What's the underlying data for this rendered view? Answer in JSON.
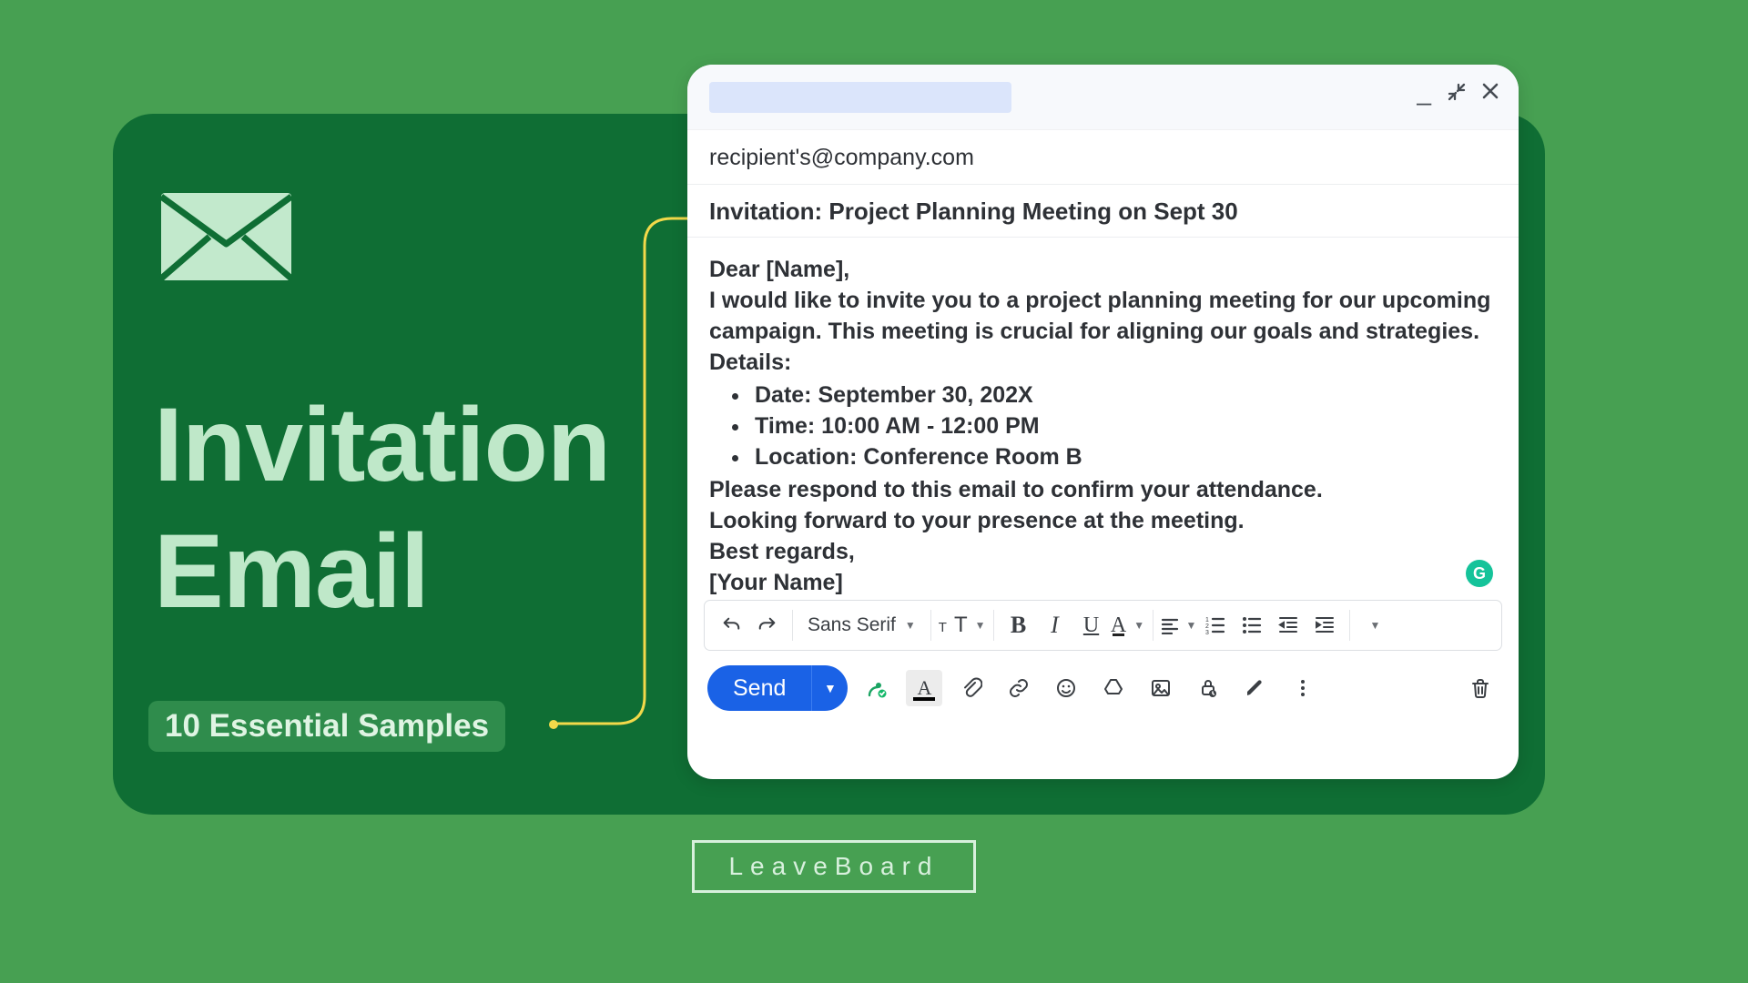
{
  "card": {
    "title_line1": "Invitation",
    "title_line2": "Email",
    "badge": "10 Essential Samples"
  },
  "compose": {
    "to": "recipient's@company.com",
    "subject": "Invitation: Project Planning Meeting on Sept 30",
    "body": {
      "greeting": "Dear [Name],",
      "intro": "I would like to invite you to a project planning meeting for our upcoming campaign. This meeting is crucial for aligning our goals and strategies.",
      "details_label": "Details:",
      "bullets": [
        "Date: September 30, 202X",
        "Time: 10:00 AM - 12:00 PM",
        "Location: Conference Room B"
      ],
      "confirm": "Please respond to this email to confirm your attendance.",
      "forward": "Looking forward to your presence at the meeting.",
      "closing": "Best regards,",
      "signature": "[Your Name]"
    },
    "toolbar": {
      "font_family": "Sans Serif"
    },
    "send_label": "Send"
  },
  "brand": "LeaveBoard"
}
